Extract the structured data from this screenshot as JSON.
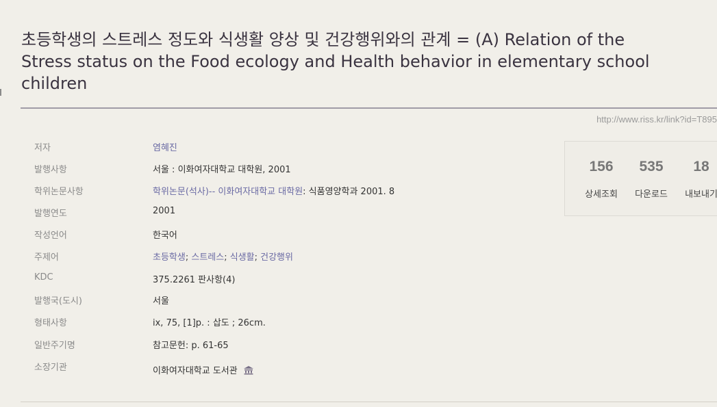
{
  "title": "초등학생의 스트레스 정도와 식생활 양상 및 건강행위와의 관계 = (A) Relation of the Stress status on the Food ecology and Health behavior in elementary school children",
  "permalink": "http://www.riss.kr/link?id=T895",
  "metadata": {
    "author": {
      "label": "저자",
      "value": "염혜진"
    },
    "publication": {
      "label": "발행사항",
      "value": "서울 : 이화여자대학교 대학원, 2001"
    },
    "thesis": {
      "label": "학위논문사항",
      "link_text": "학위논문(석사)-- 이화여자대학교 대학원",
      "rest": ": 식품영양학과 2001. 8"
    },
    "year": {
      "label": "발행연도",
      "value": "2001"
    },
    "language": {
      "label": "작성언어",
      "value": "한국어"
    },
    "subjects": {
      "label": "주제어",
      "items": [
        "초등학생",
        "스트레스",
        "식생활",
        "건강행위"
      ],
      "separator": "; "
    },
    "kdc": {
      "label": "KDC",
      "value": "375.2261 판사항(4)"
    },
    "country": {
      "label": "발행국(도시)",
      "value": "서울"
    },
    "format": {
      "label": "형태사항",
      "value": "ix, 75, [1]p. : 삽도 ; 26cm."
    },
    "note": {
      "label": "일반주기명",
      "value": "참고문헌: p. 61-65"
    },
    "holding": {
      "label": "소장기관",
      "value": "이화여자대학교 도서관",
      "icon": "library-icon"
    }
  },
  "stats": [
    {
      "value": "156",
      "label": "상세조회"
    },
    {
      "value": "535",
      "label": "다운로드"
    },
    {
      "value": "18",
      "label": "내보내기"
    }
  ],
  "colors": {
    "background": "#f1efe9",
    "title": "#3a3340",
    "link": "#6a6aa4",
    "label": "#8a8a8a",
    "rule": "#a09ba6"
  }
}
